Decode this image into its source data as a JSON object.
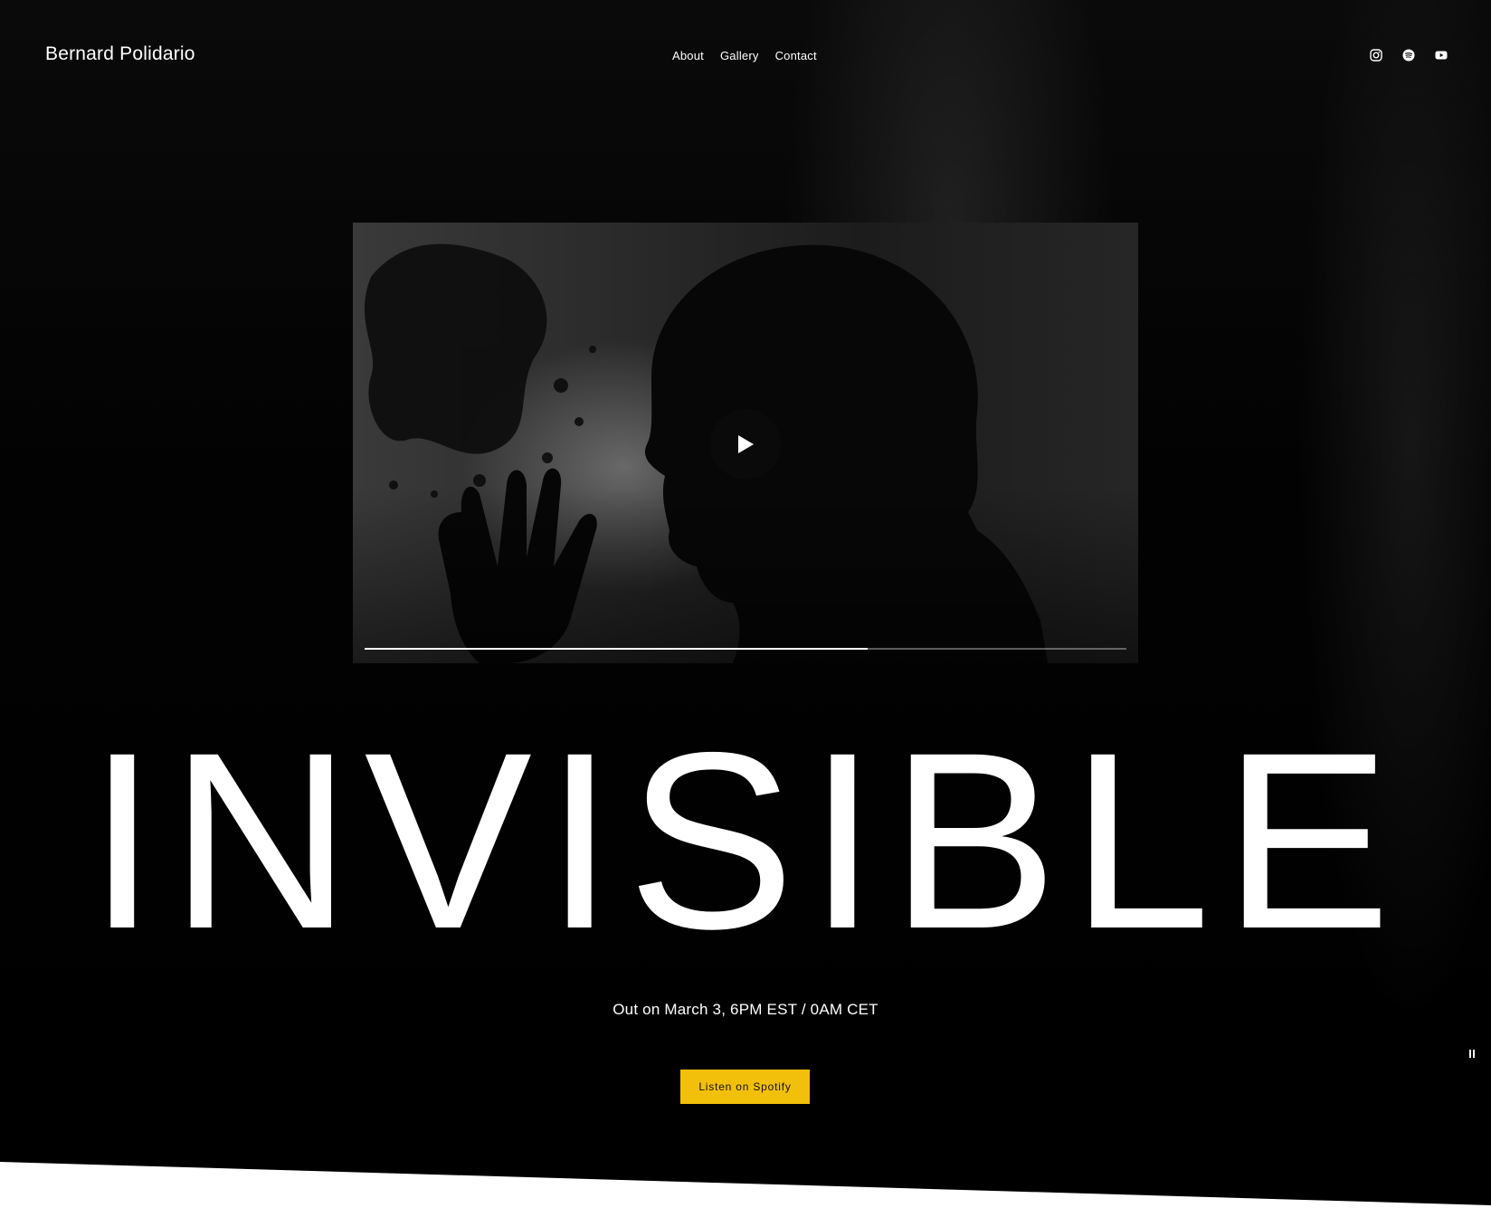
{
  "header": {
    "site_title": "Bernard Polidario",
    "nav": [
      {
        "label": "About"
      },
      {
        "label": "Gallery"
      },
      {
        "label": "Contact"
      }
    ],
    "social_icons": [
      "instagram-icon",
      "spotify-icon",
      "youtube-icon"
    ]
  },
  "video": {
    "progress_fraction": 0.66
  },
  "hero": {
    "headline": "INVISIBLE",
    "release_text": "Out on March 3, 6PM EST / 0AM CET",
    "cta_label": "Listen on Spotify"
  },
  "colors": {
    "background": "#000000",
    "accent": "#f2c00a",
    "text": "#ffffff"
  }
}
